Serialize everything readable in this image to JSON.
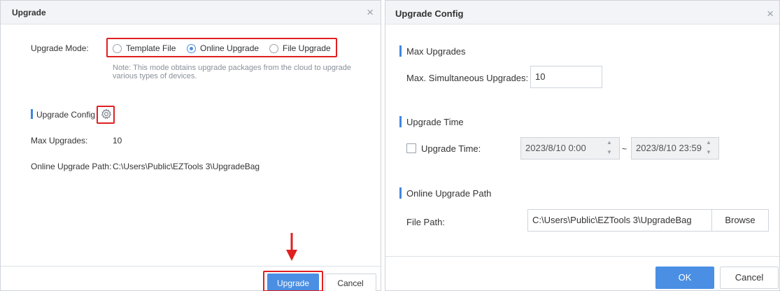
{
  "upgrade_dialog": {
    "title": "Upgrade",
    "close_glyph": "×",
    "mode_label": "Upgrade Mode:",
    "modes": [
      {
        "label": "Template File",
        "selected": false
      },
      {
        "label": "Online Upgrade",
        "selected": true
      },
      {
        "label": "File Upgrade",
        "selected": false
      }
    ],
    "note": "Note: This mode obtains upgrade packages from the cloud to upgrade various types of devices.",
    "config_title": "Upgrade Config",
    "max_upgrades_label": "Max Upgrades:",
    "max_upgrades_value": "10",
    "path_label": "Online Upgrade Path:",
    "path_value": "C:\\Users\\Public\\EZTools 3\\UpgradeBag",
    "upgrade_button": "Upgrade",
    "cancel_button": "Cancel"
  },
  "config_dialog": {
    "title": "Upgrade Config",
    "close_glyph": "×",
    "max_section": "Max Upgrades",
    "max_label": "Max. Simultaneous Upgrades:",
    "max_value": "10",
    "time_section": "Upgrade Time",
    "time_label": "Upgrade Time:",
    "time_checked": false,
    "start_time": "2023/8/10 0:00",
    "range_sep": "~",
    "end_time": "2023/8/10 23:59",
    "path_section": "Online Upgrade Path",
    "file_path_label": "File Path:",
    "file_path_value": "C:\\Users\\Public\\EZTools 3\\UpgradeBag",
    "browse_button": "Browse",
    "ok_button": "OK",
    "cancel_button": "Cancel"
  },
  "icons": {
    "spin_up": "▲",
    "spin_down": "▼"
  },
  "colors": {
    "accent": "#4a8fe3",
    "highlight": "#e02020"
  }
}
